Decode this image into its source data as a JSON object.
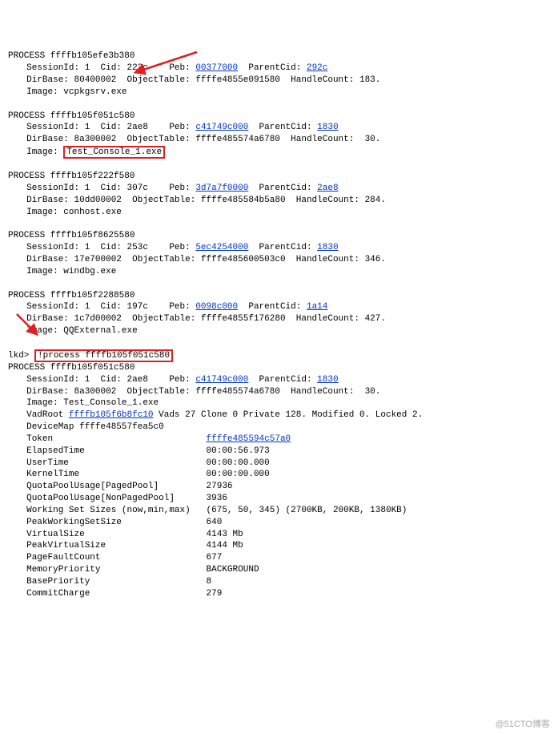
{
  "processes": [
    {
      "header": "PROCESS ffffb105efe3b380",
      "sessionIdLabel": "SessionId: 1  Cid: 223c    Peb: ",
      "peb": "00377000",
      "parentLabel": "  ParentCid: ",
      "parentCid": "292c",
      "dirbase": "DirBase: 80400002  ObjectTable: ffffe4855e091580  HandleCount: 183.",
      "image": "Image: vcpkgsrv.exe"
    },
    {
      "header": "PROCESS ffffb105f051c580",
      "sessionIdLabel": "SessionId: 1  Cid: 2ae8    Peb: ",
      "peb": "c41749c000",
      "parentLabel": "  ParentCid: ",
      "parentCid": "1830",
      "dirbase": "DirBase: 8a300002  ObjectTable: ffffe485574a6780  HandleCount:  30.",
      "imageLabel": "Image: ",
      "imageBoxed": "Test_Console_1.exe"
    },
    {
      "header": "PROCESS ffffb105f222f580",
      "sessionIdLabel": "SessionId: 1  Cid: 307c    Peb: ",
      "peb": "3d7a7f0000",
      "parentLabel": "  ParentCid: ",
      "parentCid": "2ae8",
      "dirbase": "DirBase: 10dd00002  ObjectTable: ffffe485584b5a80  HandleCount: 284.",
      "image": "Image: conhost.exe"
    },
    {
      "header": "PROCESS ffffb105f8625580",
      "sessionIdLabel": "SessionId: 1  Cid: 253c    Peb: ",
      "peb": "5ec4254000",
      "parentLabel": "  ParentCid: ",
      "parentCid": "1830",
      "dirbase": "DirBase: 17e700002  ObjectTable: ffffe485600503c0  HandleCount: 346.",
      "image": "Image: windbg.exe"
    },
    {
      "header": "PROCESS ffffb105f2288580",
      "sessionIdLabel": "SessionId: 1  Cid: 197c    Peb: ",
      "peb": "0098c000",
      "parentLabel": "  ParentCid: ",
      "parentCid": "1a14",
      "dirbase": "DirBase: 1c7d00002  ObjectTable: ffffe4855f176280  HandleCount: 427.",
      "image": "Image: QQExternal.exe"
    }
  ],
  "prompt": "lkd> ",
  "command": "!process ffffb105f051c580",
  "detail": {
    "header": "PROCESS ffffb105f051c580",
    "sessionIdLabel": "SessionId: 1  Cid: 2ae8    Peb: ",
    "peb": "c41749c000",
    "parentLabel": "  ParentCid: ",
    "parentCid": "1830",
    "dirbase": "DirBase: 8a300002  ObjectTable: ffffe485574a6780  HandleCount:  30.",
    "image": "Image: Test_Console_1.exe",
    "vadPrefix": "VadRoot ",
    "vadRoot": "ffffb105f6b8fc10",
    "vadSuffix": " Vads 27 Clone 0 Private 128. Modified 0. Locked 2.",
    "devicemap": "DeviceMap ffffe48557fea5c0",
    "tokenLabel": "Token                             ",
    "token": "ffffe485594c57a0",
    "rows": [
      {
        "k": "ElapsedTime                       ",
        "v": "00:00:56.973"
      },
      {
        "k": "UserTime                          ",
        "v": "00:00:00.000"
      },
      {
        "k": "KernelTime                        ",
        "v": "00:00:00.000"
      },
      {
        "k": "QuotaPoolUsage[PagedPool]         ",
        "v": "27936"
      },
      {
        "k": "QuotaPoolUsage[NonPagedPool]      ",
        "v": "3936"
      },
      {
        "k": "Working Set Sizes (now,min,max)   ",
        "v": "(675, 50, 345) (2700KB, 200KB, 1380KB)"
      },
      {
        "k": "PeakWorkingSetSize                ",
        "v": "640"
      },
      {
        "k": "VirtualSize                       ",
        "v": "4143 Mb"
      },
      {
        "k": "PeakVirtualSize                   ",
        "v": "4144 Mb"
      },
      {
        "k": "PageFaultCount                    ",
        "v": "677"
      },
      {
        "k": "MemoryPriority                    ",
        "v": "BACKGROUND"
      },
      {
        "k": "BasePriority                      ",
        "v": "8"
      },
      {
        "k": "CommitCharge                      ",
        "v": "279"
      }
    ]
  },
  "watermark": "@51CTO博客"
}
